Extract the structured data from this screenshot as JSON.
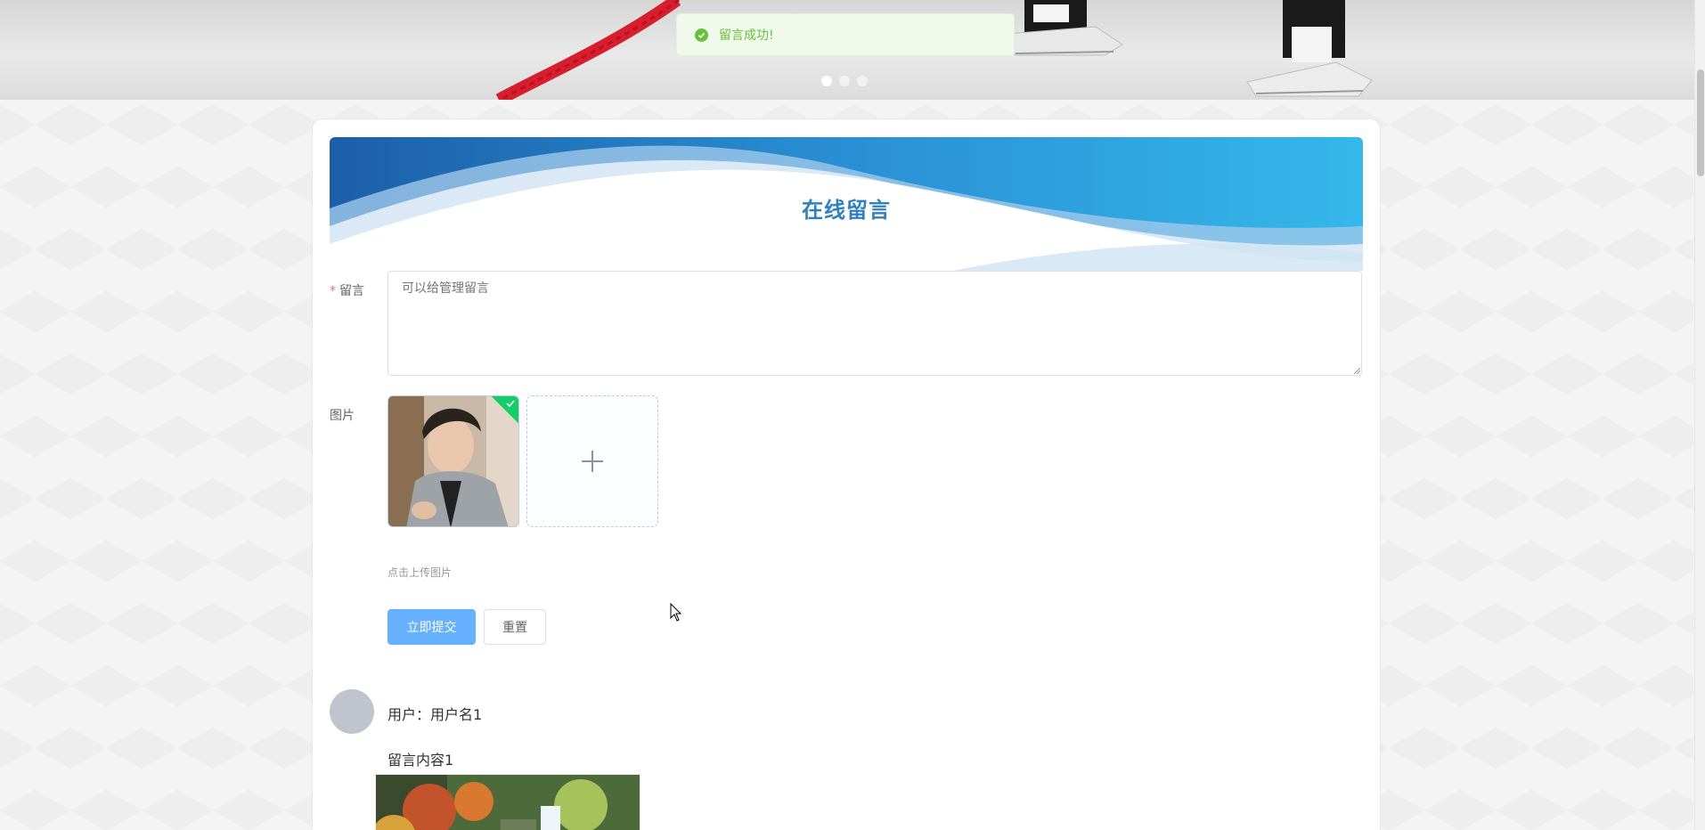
{
  "toast": {
    "message": "留言成功!",
    "icon": "success-check-icon"
  },
  "banner": {
    "slides_count": 3,
    "active_slide": 1
  },
  "form": {
    "title": "在线留言",
    "message_label": "留言",
    "message_required_mark": "*",
    "message_placeholder": "可以给管理留言",
    "image_label": "图片",
    "upload_hint": "点击上传图片",
    "submit_label": "立即提交",
    "reset_label": "重置"
  },
  "comments": [
    {
      "user_prefix": "用户：",
      "username": "用户名1",
      "content": "留言内容1"
    }
  ],
  "colors": {
    "primary": "#66b1ff",
    "success": "#67c23a",
    "title": "#2f7fc1",
    "required": "#f56c6c"
  }
}
